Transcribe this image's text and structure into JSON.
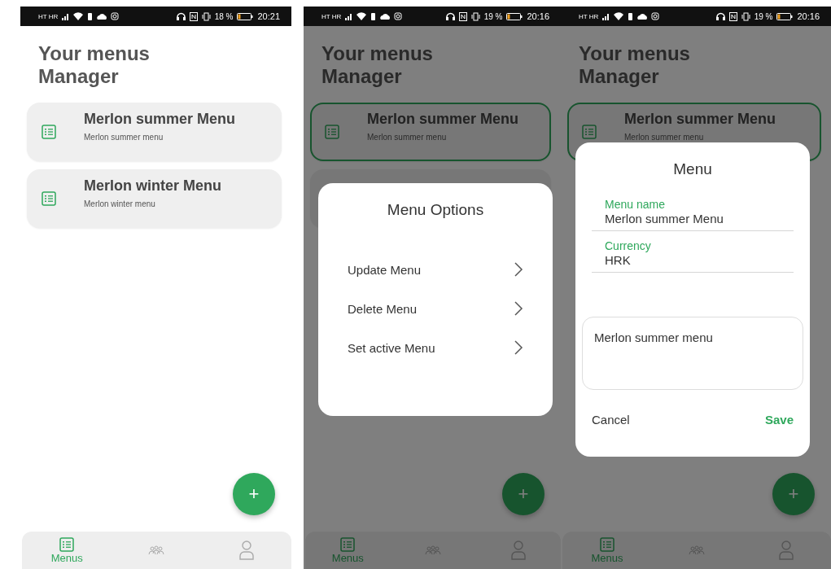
{
  "screens": [
    {
      "status_bar": {
        "carrier": "HT HR",
        "battery": "18 %",
        "time": "20:21"
      },
      "title": "Your menus Manager",
      "menus": [
        {
          "name": "Merlon summer Menu",
          "description": "Merlon summer menu",
          "selected": false
        },
        {
          "name": "Merlon winter Menu",
          "description": "Merlon winter menu",
          "selected": false
        }
      ],
      "fab": "+",
      "nav": [
        {
          "label": "Menus",
          "selected": true
        },
        {
          "selected": false
        },
        {
          "selected": false
        }
      ]
    },
    {
      "status_bar": {
        "carrier": "HT HR",
        "battery": "19 %",
        "time": "20:16"
      },
      "title": "Your menus Manager",
      "menus": [
        {
          "name": "Merlon summer Menu",
          "description": "Merlon summer menu",
          "selected": true
        },
        {
          "selected": false
        }
      ],
      "fab": "+",
      "nav": [
        {
          "label": "Menus",
          "selected": true
        },
        {
          "selected": false
        },
        {
          "selected": false
        }
      ],
      "dialog": {
        "kind": "options",
        "title": "Menu Options",
        "options": [
          "Update Menu",
          "Delete Menu",
          "Set active Menu"
        ]
      }
    },
    {
      "status_bar": {
        "carrier": "HT HR",
        "battery": "19 %",
        "time": "20:16"
      },
      "title": "Your menus Manager",
      "menus": [
        {
          "name": "Merlon summer Menu",
          "description": "Merlon summer menu",
          "selected": true
        }
      ],
      "fab": "+",
      "nav": [
        {
          "label": "Menus",
          "selected": true
        },
        {
          "selected": false
        },
        {
          "selected": false
        }
      ],
      "dialog": {
        "kind": "form",
        "title": "Menu",
        "fields": [
          {
            "label": "Menu name",
            "value": "Merlon summer Menu"
          },
          {
            "label": "Currency",
            "value": "HRK"
          }
        ],
        "description": "Merlon summer menu",
        "cancel": "Cancel",
        "save": "Save"
      }
    }
  ]
}
